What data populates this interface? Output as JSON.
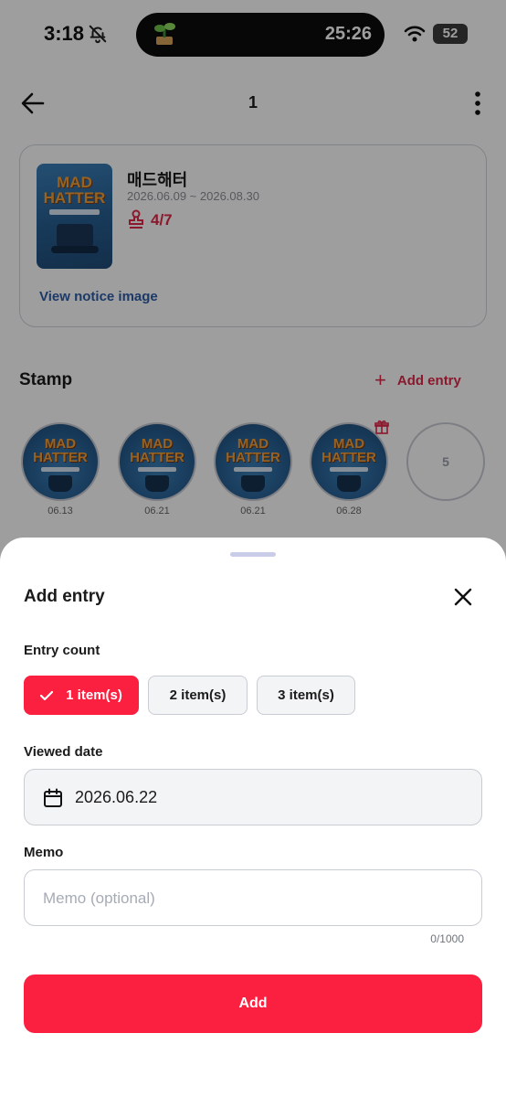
{
  "status_bar": {
    "time": "3:18",
    "timer": "25:26",
    "battery": "52"
  },
  "app_bar": {
    "title": "1"
  },
  "show": {
    "name": "매드해터",
    "period": "2026.06.09 ~ 2026.08.30",
    "progress": "4/7",
    "notice_link": "View notice image",
    "poster_title_line1": "MAD",
    "poster_title_line2": "HATTER"
  },
  "stamps": {
    "title": "Stamp",
    "add_entry_label": "Add entry",
    "items": [
      {
        "date": "06.13",
        "has_gift": false
      },
      {
        "date": "06.21",
        "has_gift": false
      },
      {
        "date": "06.21",
        "has_gift": false
      },
      {
        "date": "06.28",
        "has_gift": true
      }
    ],
    "next_slot_number": "5"
  },
  "sheet": {
    "title": "Add entry",
    "entry_count_label": "Entry count",
    "entry_options": [
      "1 item(s)",
      "2 item(s)",
      "3 item(s)"
    ],
    "selected_option_index": 0,
    "viewed_date_label": "Viewed date",
    "viewed_date_value": "2026.06.22",
    "memo_label": "Memo",
    "memo_placeholder": "Memo (optional)",
    "memo_value": "",
    "memo_counter": "0/1000",
    "submit_label": "Add"
  },
  "colors": {
    "accent": "#fb1f40",
    "link": "#2e5ea8",
    "progress": "#e0284a"
  }
}
